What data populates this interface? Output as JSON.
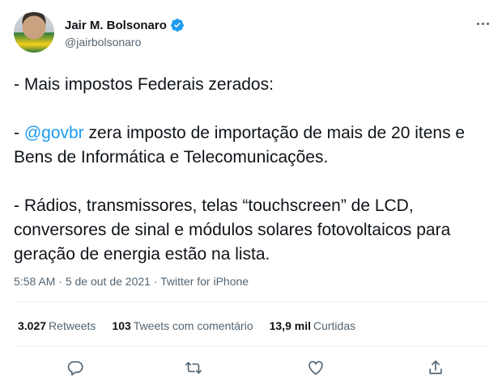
{
  "user": {
    "display_name": "Jair M. Bolsonaro",
    "handle": "@jairbolsonaro",
    "verified": true
  },
  "tweet": {
    "line1": "- Mais impostos Federais zerados:",
    "line2_prefix": "- ",
    "line2_mention": "@govbr",
    "line2_rest": " zera imposto de importação de mais de 20 itens e Bens de Informática e Telecomunicações.",
    "line3": "- Rádios, transmissores, telas “touchscreen” de LCD, conversores de sinal e módulos solares fotovoltaicos para geração de energia estão na lista."
  },
  "meta": {
    "time": "5:58 AM",
    "separator1": " · ",
    "date": "5 de out de 2021",
    "separator2": " · ",
    "source": "Twitter for iPhone"
  },
  "stats": {
    "retweets_count": "3.027",
    "retweets_label": "Retweets",
    "quotes_count": "103",
    "quotes_label": "Tweets com comentário",
    "likes_count": "13,9 mil",
    "likes_label": "Curtidas"
  },
  "icons": {
    "more": "more-icon",
    "reply": "reply-icon",
    "retweet": "retweet-icon",
    "like": "like-icon",
    "share": "share-icon",
    "verified": "verified-badge-icon"
  },
  "colors": {
    "accent": "#1d9bf0",
    "text": "#0f1419",
    "secondary": "#536471"
  }
}
